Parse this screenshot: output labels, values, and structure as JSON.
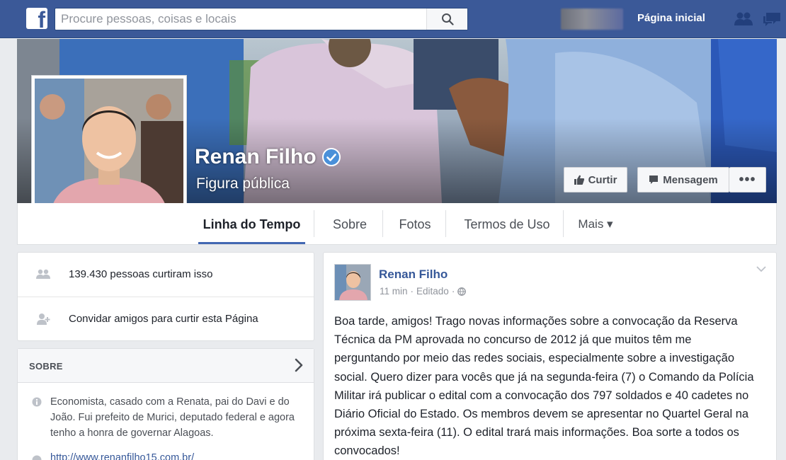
{
  "topbar": {
    "logo": "f",
    "search_placeholder": "Procure pessoas, coisas e locais",
    "home_label": "Página inicial",
    "icons": [
      "search-icon",
      "friends-icon",
      "messages-icon"
    ]
  },
  "profile": {
    "name": "Renan Filho",
    "category": "Figura pública",
    "verified": true
  },
  "actions": {
    "like_label": "Curtir",
    "message_label": "Mensagem",
    "more_label": "•••"
  },
  "tabs": [
    {
      "label": "Linha do Tempo",
      "active": true
    },
    {
      "label": "Sobre"
    },
    {
      "label": "Fotos"
    },
    {
      "label": "Termos de Uso"
    },
    {
      "label": "Mais ▾"
    }
  ],
  "likes": {
    "count_text": "139.430 pessoas curtiram isso",
    "invite_text": "Convidar amigos para curtir esta Página"
  },
  "about": {
    "title": "SOBRE",
    "bio": "Economista, casado com a Renata, pai do Davi e do João. Fui prefeito de Murici, deputado federal e agora tenho a honra de governar Alagoas.",
    "website": "http://www.renanfilho15.com.br/"
  },
  "post": {
    "author": "Renan Filho",
    "time": "11 min",
    "edited": "Editado",
    "separator": "·",
    "text": "Boa tarde, amigos! Trago novas informações sobre a convocação da Reserva Técnica da PM aprovada no concurso de 2012 já que muitos têm me perguntando por meio das redes sociais, especialmente sobre a investigação social. Quero dizer para vocês que já na segunda-feira (7) o Comando da Polícia Militar irá publicar o edital com a convocação dos 797 soldados e 40 cadetes no Diário Oficial do Estado. Os membros devem se apresentar no Quartel Geral na próxima sexta-feira (11). O edital trará mais informações. Boa sorte a todos os convocados!"
  },
  "colors": {
    "brand": "#3b5998",
    "link": "#365899",
    "tab_active": "#4267b2",
    "background": "#e9ebee"
  }
}
